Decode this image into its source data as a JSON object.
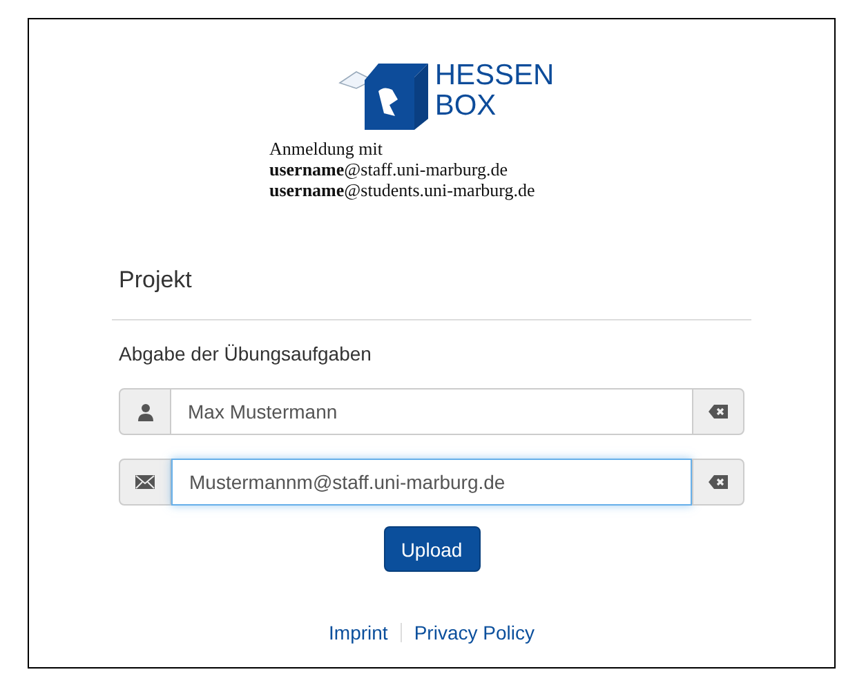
{
  "logo": {
    "lines": [
      "HESSEN",
      "BOX"
    ]
  },
  "intro": [
    "Anmeldung mit",
    "**username**@staff.uni-marburg.de",
    "**username**@students.uni-marburg.de"
  ],
  "panel": {
    "title": "Projekt",
    "subtitle": "Abgabe der Übungsaufgaben"
  },
  "fields": [
    {
      "kind": "person",
      "value": "Max Mustermann",
      "focused": false
    },
    {
      "kind": "mail",
      "value": "Mustermannm@staff.uni-marburg.de",
      "focused": true
    }
  ],
  "submit": "Upload",
  "footer": [
    "Imprint",
    "Privacy Policy"
  ]
}
